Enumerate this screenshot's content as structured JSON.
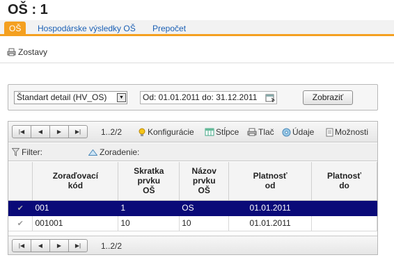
{
  "header": {
    "title": "OŠ :  1"
  },
  "tabs": [
    {
      "label": "OŠ",
      "active": true
    },
    {
      "label": "Hospodárske výsledky OŠ",
      "active": false
    },
    {
      "label": "Prepočet",
      "active": false
    }
  ],
  "subbar": {
    "reports_label": "Zostavy"
  },
  "filter_panel": {
    "view_select": "Štandart detail (HV_OS)",
    "date_range": "Od: 01.01.2011 do: 31.12.2011",
    "show_button": "Zobraziť"
  },
  "grid": {
    "page_info": "1..2/2",
    "toolbar": {
      "configurations": "Konfigurácie",
      "columns": "Stĺpce",
      "print": "Tlač",
      "data": "Údaje",
      "options": "Možnosti"
    },
    "filter_label": "Filter:",
    "sort_label": "Zoradenie:",
    "columns": [
      "",
      "Zoraďovací\nkód",
      "Skratka\nprvku\nOŠ",
      "Názov\nprvku\nOŠ",
      "Platnosť\nod",
      "Platnosť\ndo"
    ],
    "rows": [
      {
        "code": "001",
        "short": "1",
        "name": "OS",
        "valid_from": "01.01.2011",
        "valid_to": "",
        "selected": true
      },
      {
        "code": "001001",
        "short": "10",
        "name": "10",
        "valid_from": "01.01.2011",
        "valid_to": "",
        "selected": false
      }
    ],
    "bottom_page_info": "1..2/2"
  },
  "colors": {
    "accent": "#f4a020",
    "link": "#1a5fb4",
    "selected_row": "#0a0a78"
  }
}
